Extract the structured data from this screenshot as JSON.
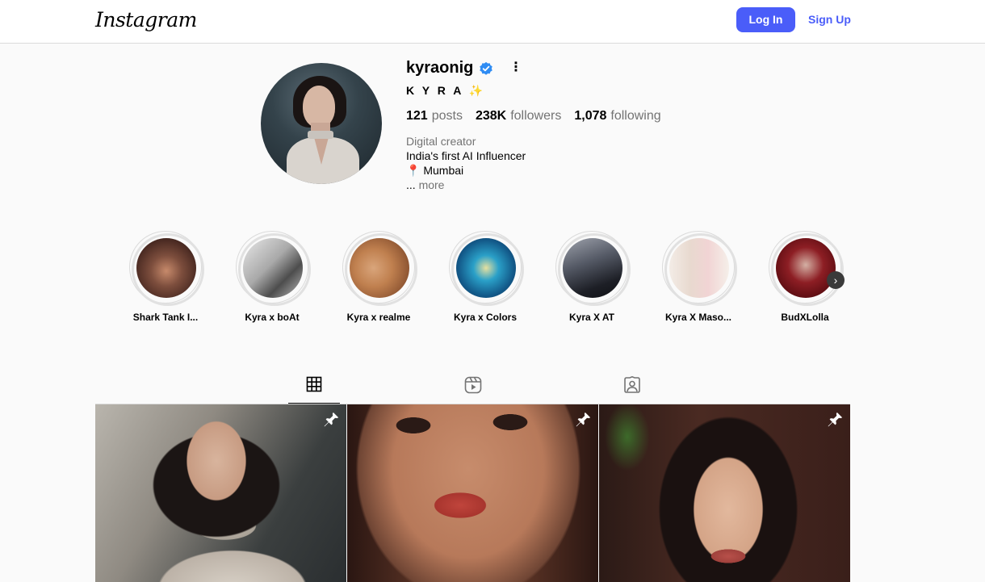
{
  "topbar": {
    "logo": "Instagram",
    "login_label": "Log In",
    "signup_label": "Sign Up",
    "accent_color": "#4a5df9"
  },
  "profile": {
    "username": "kyraonig",
    "verified": true,
    "full_name": "K Y R A",
    "sparkle": "✨",
    "stats": [
      {
        "value": "121",
        "label": "posts"
      },
      {
        "value": "238K",
        "label": "followers"
      },
      {
        "value": "1,078",
        "label": "following"
      }
    ],
    "category": "Digital creator",
    "bio_line1": "India's first AI Influencer",
    "bio_pin": "📍",
    "bio_line2": "Mumbai",
    "bio_ellipsis": "...",
    "bio_more": "more"
  },
  "highlights": [
    {
      "label": "Shark Tank I..."
    },
    {
      "label": "Kyra x boAt"
    },
    {
      "label": "Kyra x realme"
    },
    {
      "label": "Kyra x Colors"
    },
    {
      "label": "Kyra X AT"
    },
    {
      "label": "Kyra X Maso..."
    },
    {
      "label": "BudXLolla"
    }
  ],
  "tabs": [
    {
      "icon": "grid-icon",
      "active": true
    },
    {
      "icon": "reels-icon",
      "active": false
    },
    {
      "icon": "tagged-icon",
      "active": false
    }
  ],
  "posts": [
    {
      "pinned": true
    },
    {
      "pinned": true
    },
    {
      "pinned": true
    }
  ]
}
